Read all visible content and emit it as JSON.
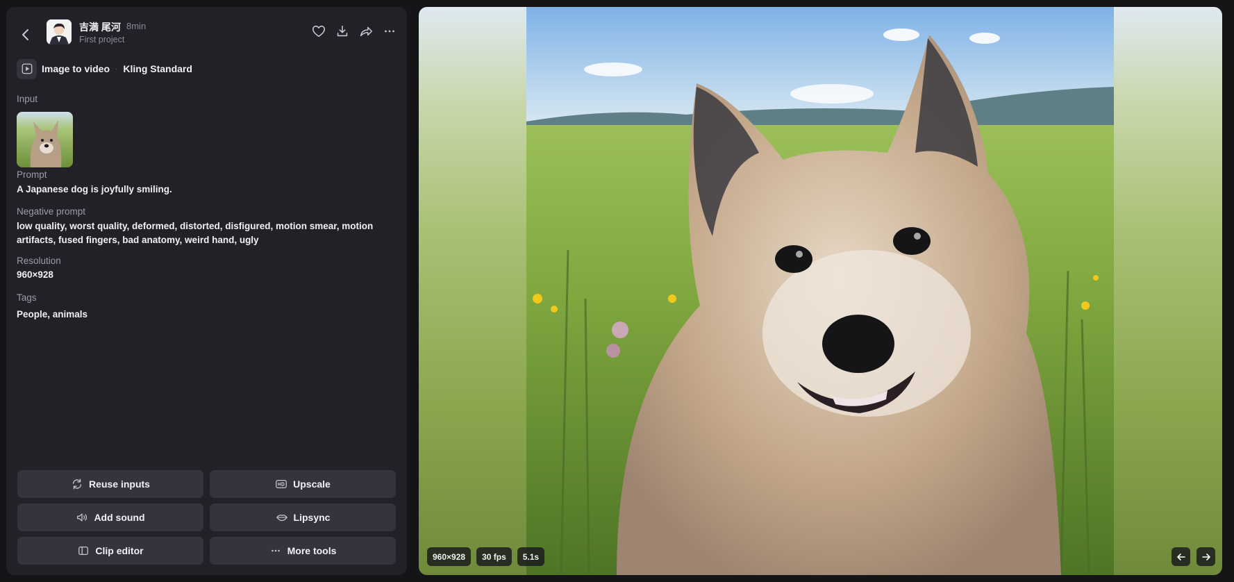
{
  "header": {
    "user_name": "吉満 尾河",
    "time_ago": "8min",
    "project": "First project",
    "icons": [
      "back-arrow-icon",
      "heart-icon",
      "download-icon",
      "share-icon",
      "more-icon"
    ]
  },
  "mode": {
    "type": "Image to video",
    "separator": "·",
    "model": "Kling Standard"
  },
  "details": {
    "input_label": "Input",
    "prompt_label": "Prompt",
    "prompt": "A Japanese dog is joyfully smiling.",
    "negative_label": "Negative prompt",
    "negative_prompt": "low quality, worst quality, deformed, distorted, disfigured, motion smear, motion artifacts, fused fingers, bad anatomy, weird hand, ugly",
    "resolution_label": "Resolution",
    "resolution": "960×928",
    "tags_label": "Tags",
    "tags": "People, animals"
  },
  "actions": {
    "reuse": "Reuse inputs",
    "upscale": "Upscale",
    "add_sound": "Add sound",
    "lipsync": "Lipsync",
    "clip_editor": "Clip editor",
    "more_tools": "More tools"
  },
  "preview": {
    "resolution": "960×928",
    "fps": "30 fps",
    "duration": "5.1s"
  },
  "colors": {
    "panel_bg": "#222128",
    "button_bg": "#35343e",
    "page_bg": "#151518"
  }
}
